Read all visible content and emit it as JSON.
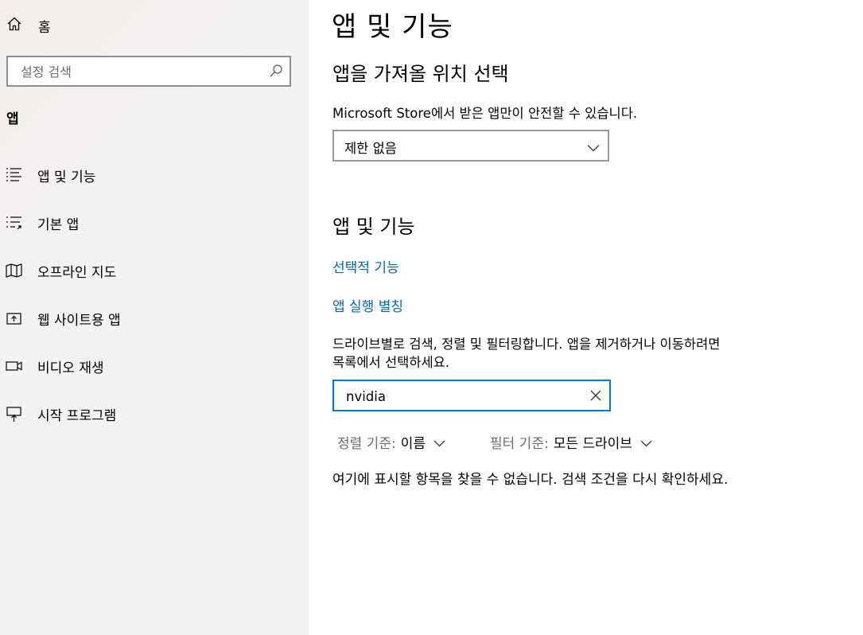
{
  "sidebar": {
    "home_label": "홈",
    "search_placeholder": "설정 검색",
    "section_heading": "앱",
    "items": [
      {
        "label": "앱 및 기능",
        "icon": "apps-features-icon"
      },
      {
        "label": "기본 앱",
        "icon": "default-apps-icon"
      },
      {
        "label": "오프라인 지도",
        "icon": "offline-maps-icon"
      },
      {
        "label": "웹 사이트용 앱",
        "icon": "apps-for-websites-icon"
      },
      {
        "label": "비디오 재생",
        "icon": "video-playback-icon"
      },
      {
        "label": "시작 프로그램",
        "icon": "startup-icon"
      }
    ]
  },
  "main": {
    "title": "앱 및 기능",
    "install_section": {
      "heading": "앱을 가져올 위치 선택",
      "description": "Microsoft Store에서 받은 앱만이 안전할 수 있습니다.",
      "dropdown_value": "제한 없음"
    },
    "apps_section": {
      "heading": "앱 및 기능",
      "link_optional_features": "선택적 기능",
      "link_app_aliases": "앱 실행 별칭",
      "description_line1": "드라이브별로 검색, 정렬 및 필터링합니다. 앱을 제거하거나 이동하려면",
      "description_line2": "목록에서 선택하세요.",
      "filter_value": "nvidia",
      "sort_label": "정렬 기준:",
      "sort_value": "이름",
      "filter_label": "필터 기준:",
      "filter_drive_value": "모든 드라이브",
      "empty_message": "여기에 표시할 항목을 찾을 수 없습니다. 검색 조건을 다시 확인하세요."
    }
  },
  "colors": {
    "accent": "#0078d7",
    "link": "#0067b8",
    "sidebar_bg": "#f2f2f2",
    "muted_text": "#6b6b6b"
  }
}
